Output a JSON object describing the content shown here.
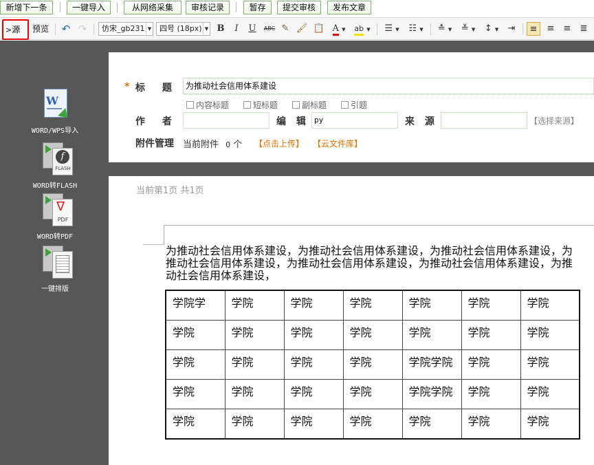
{
  "action_bar": {
    "buttons": [
      "新增下一条",
      "一键导入",
      "从网络采集",
      "审核记录",
      "暂存",
      "提交审核",
      "发布文章"
    ]
  },
  "toolbar": {
    "source_label": "源码",
    "preview_label": "预览",
    "font_family": "仿宋_gb231",
    "font_size": "四号 (18px)",
    "bold": "B",
    "italic": "I",
    "underline": "U",
    "strike": "ABC",
    "font_color": "A",
    "highlight": "ab"
  },
  "sidebar": {
    "tools": [
      {
        "label": "WORD/WPS导入",
        "icon": "word-import-icon"
      },
      {
        "label": "WORD转FLASH",
        "icon": "word-to-flash-icon"
      },
      {
        "label": "WORD转PDF",
        "icon": "word-to-pdf-icon"
      },
      {
        "label": "一键排版",
        "icon": "one-click-layout-icon"
      }
    ],
    "flash_text": "FLASH",
    "pdf_text": "PDF"
  },
  "form": {
    "required_mark": "*",
    "title_label": "标 题",
    "title_value": "为推动社会信用体系建设",
    "checkboxes": [
      "内容标题",
      "短标题",
      "副标题",
      "引题"
    ],
    "author_label": "作 者",
    "author_value": "",
    "editor_label": "编 辑",
    "editor_value": "py",
    "source_label": "来 源",
    "source_value": "",
    "select_source": "【选择来源】",
    "attachment_label": "附件管理",
    "attachment_text": "当前附件",
    "attachment_count": "0",
    "attachment_unit": "个",
    "upload_link": "【点击上传】",
    "cloud_link": "【云文件库】"
  },
  "document": {
    "page_info": "当前第1页  共1页",
    "paragraph_lines": [
      "为推动社会信用体系建设，为推动社会信用体系建设，为推动社会信用体系建设，为",
      "推动社会信用体系建设，为推动社会信用体系建设，为推动社会信用体系建设，为推",
      "动社会信用体系建设，"
    ],
    "table_rows": [
      [
        "学院学",
        "学院",
        "学院",
        "学院",
        "学院",
        "学院",
        "学院"
      ],
      [
        "学院",
        "学院",
        "学院",
        "学院",
        "学院",
        "学院",
        "学院"
      ],
      [
        "学院",
        "学院",
        "学院",
        "学院",
        "学院学院",
        "学院",
        "学院"
      ],
      [
        "学院",
        "学院",
        "学院",
        "学院",
        "学院学院",
        "学院",
        "学院"
      ],
      [
        "学院",
        "学院",
        "学院",
        "学院",
        "学院",
        "学院",
        "学院"
      ]
    ]
  },
  "colors": {
    "button_border": "#7bb46a",
    "highlight_red": "#e00000",
    "sidebar_bg": "#575757",
    "link_orange": "#e37300"
  }
}
